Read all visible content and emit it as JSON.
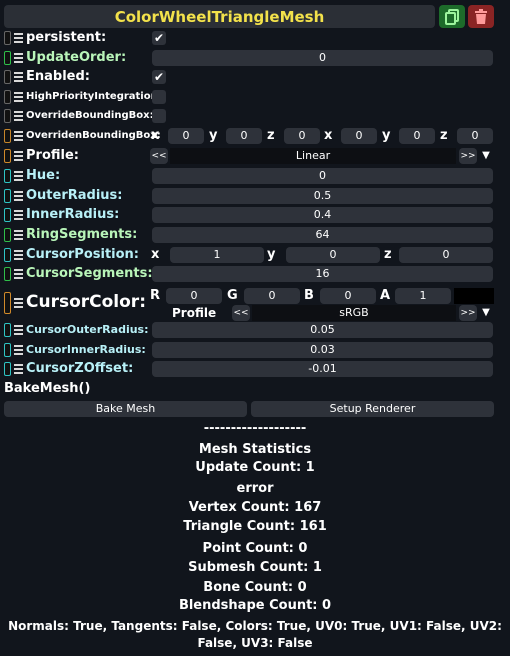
{
  "header": {
    "title": "ColorWheelTriangleMesh"
  },
  "fields": {
    "persistent": {
      "label": "persistent:",
      "checked": "✔"
    },
    "update_order": {
      "label": "UpdateOrder:",
      "value": "0"
    },
    "enabled": {
      "label": "Enabled:",
      "checked": "✔"
    },
    "high_priority": {
      "label": "HighPriorityIntegration:"
    },
    "override_bbox": {
      "label": "OverrideBoundingBox:"
    },
    "overriden_bbox": {
      "label": "OverridenBoundingBox:",
      "axes": [
        "x",
        "y",
        "z",
        "x",
        "y",
        "z"
      ],
      "values": [
        "0",
        "0",
        "0",
        "0",
        "0",
        "0"
      ]
    },
    "profile": {
      "label": "Profile:",
      "value": "Linear",
      "prev": "<<",
      "next": ">>",
      "dropdown": "▼"
    },
    "hue": {
      "label": "Hue:",
      "value": "0"
    },
    "outer_radius": {
      "label": "OuterRadius:",
      "value": "0.5"
    },
    "inner_radius": {
      "label": "InnerRadius:",
      "value": "0.4"
    },
    "ring_segments": {
      "label": "RingSegments:",
      "value": "64"
    },
    "cursor_position": {
      "label": "CursorPosition:",
      "axes": [
        "x",
        "y",
        "z"
      ],
      "values": [
        "1",
        "0",
        "0"
      ]
    },
    "cursor_segments": {
      "label": "CursorSegments:",
      "value": "16"
    },
    "cursor_color": {
      "label": "CursorColor:",
      "channels": [
        "R",
        "G",
        "B",
        "A"
      ],
      "values": [
        "0",
        "0",
        "0",
        "1"
      ],
      "swatch": "#000000",
      "profile_label": "Profile",
      "profile_value": "sRGB",
      "prev": "<<",
      "next": ">>",
      "dropdown": "▼"
    },
    "cursor_outer_radius": {
      "label": "CursorOuterRadius:",
      "value": "0.05"
    },
    "cursor_inner_radius": {
      "label": "CursorInnerRadius:",
      "value": "0.03"
    },
    "cursor_z_offset": {
      "label": "CursorZOffset:",
      "value": "-0.01"
    }
  },
  "bake": {
    "label": "BakeMesh()",
    "bake_button": "Bake Mesh",
    "setup_button": "Setup Renderer"
  },
  "stats": {
    "separator": "-------------------",
    "title": "Mesh Statistics",
    "update_count": "Update Count: 1",
    "error": "error",
    "vertex_count": "Vertex Count: 167",
    "triangle_count": "Triangle Count: 161",
    "point_count": "Point Count: 0",
    "submesh_count": "Submesh Count: 1",
    "bone_count": "Bone Count: 0",
    "blendshape_count": "Blendshape Count: 0",
    "normals_line1": "Normals: True, Tangents: False, Colors: True, UV0: True, UV1: False, UV2:",
    "normals_line2": "False, UV3: False"
  },
  "colors": {
    "title": "#f3e24b",
    "green_label": "#b9f5b9",
    "cyan_label": "#b8f0f7",
    "duplicate": "#1d6b2a",
    "delete": "#8a2424"
  }
}
